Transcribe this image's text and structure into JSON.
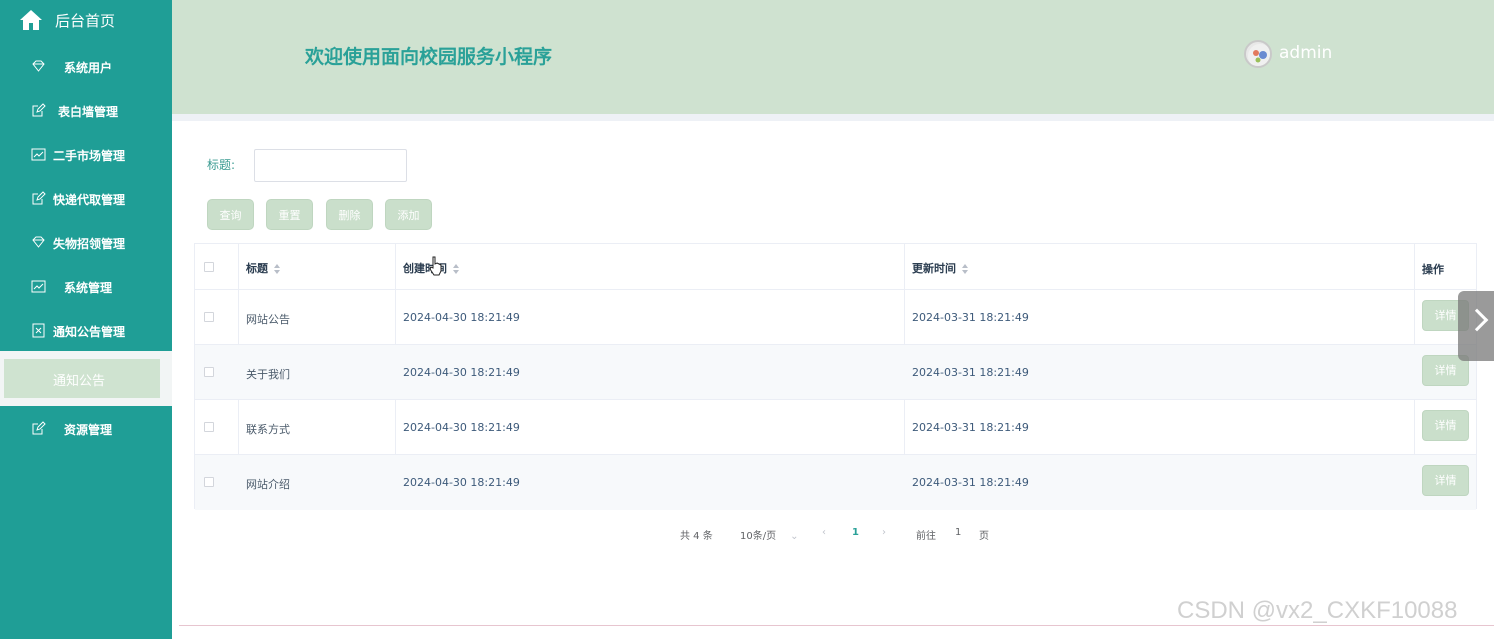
{
  "sidebar": {
    "home_label": "后台首页",
    "items": [
      {
        "label": "系统用户",
        "icon": "diamond-icon"
      },
      {
        "label": "表白墙管理",
        "icon": "edit-icon"
      },
      {
        "label": "二手市场管理",
        "icon": "chart-icon"
      },
      {
        "label": "快递代取管理",
        "icon": "edit-icon"
      },
      {
        "label": "失物招领管理",
        "icon": "diamond-icon"
      },
      {
        "label": "系统管理",
        "icon": "chart-icon"
      },
      {
        "label": "通知公告管理",
        "icon": "document-icon"
      },
      {
        "label": "资源管理",
        "icon": "edit-icon"
      }
    ],
    "active_sub": "通知公告"
  },
  "header": {
    "title": "欢迎使用面向校园服务小程序",
    "username": "admin"
  },
  "search": {
    "label": "标题:",
    "value": ""
  },
  "buttons": {
    "query": "查询",
    "reset": "重置",
    "delete": "删除",
    "add": "添加"
  },
  "table": {
    "columns": [
      "标题",
      "创建时间",
      "更新时间",
      "操作"
    ],
    "rows": [
      {
        "title": "网站公告",
        "created": "2024-04-30 18:21:49",
        "updated": "2024-03-31 18:21:49",
        "action": "详情"
      },
      {
        "title": "关于我们",
        "created": "2024-04-30 18:21:49",
        "updated": "2024-03-31 18:21:49",
        "action": "详情"
      },
      {
        "title": "联系方式",
        "created": "2024-04-30 18:21:49",
        "updated": "2024-03-31 18:21:49",
        "action": "详情"
      },
      {
        "title": "网站介绍",
        "created": "2024-04-30 18:21:49",
        "updated": "2024-03-31 18:21:49",
        "action": "详情"
      }
    ]
  },
  "pagination": {
    "total": "共 4 条",
    "page_size": "10条/页",
    "current": "1",
    "goto_label": "前往",
    "goto_value": "1",
    "page_suffix": "页"
  },
  "watermark": "CSDN @vx2_CXKF10088"
}
